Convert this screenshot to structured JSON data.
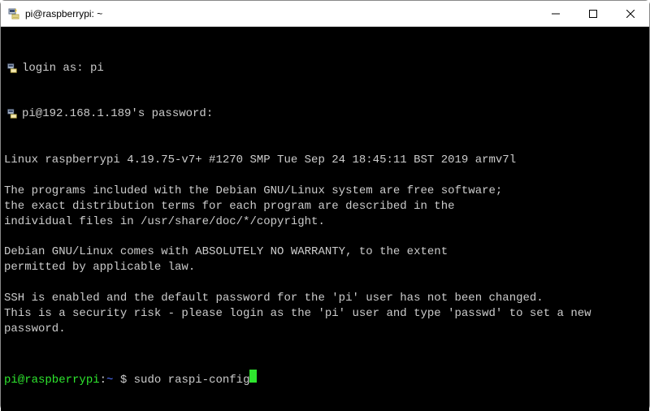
{
  "window": {
    "title": "pi@raspberrypi: ~"
  },
  "login": {
    "line1": "login as: pi",
    "line2": "pi@192.168.1.189's password:"
  },
  "motd": "Linux raspberrypi 4.19.75-v7+ #1270 SMP Tue Sep 24 18:45:11 BST 2019 armv7l\n\nThe programs included with the Debian GNU/Linux system are free software;\nthe exact distribution terms for each program are described in the\nindividual files in /usr/share/doc/*/copyright.\n\nDebian GNU/Linux comes with ABSOLUTELY NO WARRANTY, to the extent\npermitted by applicable law.\n\nSSH is enabled and the default password for the 'pi' user has not been changed.\nThis is a security risk - please login as the 'pi' user and type 'passwd' to set a new password.\n",
  "prompt": {
    "user_host": "pi@raspberrypi",
    "colon": ":",
    "cwd": "~",
    "dollar": " $ ",
    "command": "sudo raspi-config"
  }
}
